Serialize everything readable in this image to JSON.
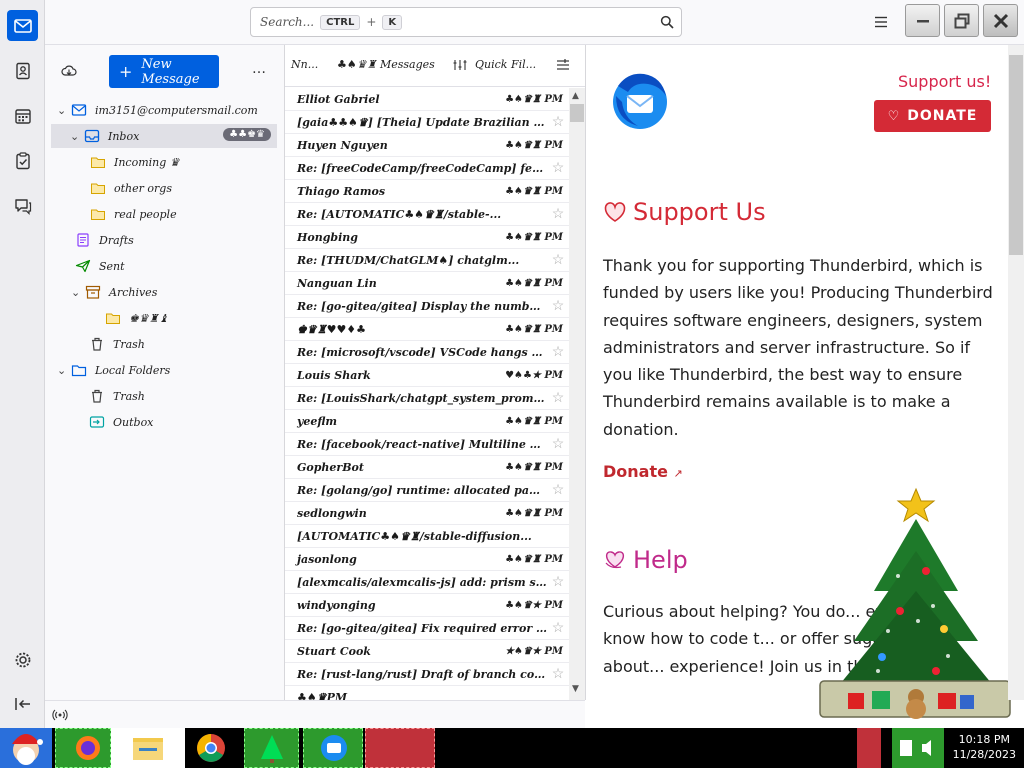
{
  "search": {
    "placeholder": "Search...",
    "key1": "CTRL",
    "sep": "+",
    "key2": "K"
  },
  "folders": {
    "new_message": "New Message",
    "more": "…",
    "account": "im3151@computersmail.com",
    "items": [
      {
        "label": "Inbox",
        "badge": "♣♣♚♛"
      },
      {
        "label": "Incoming ♛"
      },
      {
        "label": "other orgs"
      },
      {
        "label": "real people"
      },
      {
        "label": "Drafts"
      },
      {
        "label": "Sent"
      },
      {
        "label": "Archives"
      },
      {
        "label": "♚♛♜♝"
      },
      {
        "label": "Trash"
      },
      {
        "label": "Local Folders"
      },
      {
        "label": "Trash"
      },
      {
        "label": "Outbox"
      }
    ]
  },
  "list_header": {
    "col1": "Nn...",
    "col2": "♣♠♛♜ Messages",
    "col3": "Quick Fil..."
  },
  "messages": [
    {
      "text": "Elliot Gabriel",
      "time": "♣♠♛♜ PM",
      "star": ""
    },
    {
      "text": "[gaia♣♣♠♛] [Theia] Update Brazilian Po...",
      "time": "",
      "star": "☆"
    },
    {
      "text": "Huyen Nguyen",
      "time": "♣♠♛♜ PM",
      "star": ""
    },
    {
      "text": "Re: [freeCodeCamp/freeCodeCamp] feat(cu...",
      "time": "",
      "star": "☆"
    },
    {
      "text": "Thiago Ramos",
      "time": "♣♠♛♜ PM",
      "star": ""
    },
    {
      "text": "Re: [AUTOMATIC♣♠♛♜/stable-...",
      "time": "",
      "star": "☆"
    },
    {
      "text": "Hongbing",
      "time": "♣♠♛♜ PM",
      "star": ""
    },
    {
      "text": "Re: [THUDM/ChatGLM♠] chatglm...",
      "time": "",
      "star": "☆"
    },
    {
      "text": "Nanguan Lin",
      "time": "♣♠♛♜ PM",
      "star": ""
    },
    {
      "text": "Re: [go-gitea/gitea] Display the number of ...",
      "time": "",
      "star": "☆"
    },
    {
      "text": "♚♛♜♥♥♦♣",
      "time": "♣♠♛♜ PM",
      "star": ""
    },
    {
      "text": "Re: [microsoft/vscode] VSCode hangs whe...",
      "time": "",
      "star": "☆"
    },
    {
      "text": "Louis Shark",
      "time": "♥♠♣★ PM",
      "star": ""
    },
    {
      "text": "Re: [LouisShark/chatgpt_system_prompt]...",
      "time": "",
      "star": "☆"
    },
    {
      "text": "yeeflm",
      "time": "♣♠♛♜ PM",
      "star": ""
    },
    {
      "text": "Re: [facebook/react-native] Multiline Text...",
      "time": "",
      "star": "☆"
    },
    {
      "text": "GopherBot",
      "time": "♣♠♛♜ PM",
      "star": ""
    },
    {
      "text": "Re: [golang/go] runtime: allocated pages bel...",
      "time": "",
      "star": "☆"
    },
    {
      "text": "sedlongwin",
      "time": "♣♠♛♜ PM",
      "star": ""
    },
    {
      "text": "[AUTOMATIC♣♠♛♜/stable-diffusion...",
      "time": "",
      "star": ""
    },
    {
      "text": "jasonlong",
      "time": "♣♠♛♜ PM",
      "star": ""
    },
    {
      "text": "[alexmcalis/alexmcalis-js] add: prism support...",
      "time": "",
      "star": "☆"
    },
    {
      "text": "windyonging",
      "time": "♣♠♛★ PM",
      "star": ""
    },
    {
      "text": "Re: [go-gitea/gitea] Fix required error for t...",
      "time": "",
      "star": "☆"
    },
    {
      "text": "Stuart Cook",
      "time": "★♠♛★ PM",
      "star": ""
    },
    {
      "text": "Re: [rust-lang/rust] Draft of branch cov...",
      "time": "",
      "star": "☆"
    },
    {
      "text": "♣♠♛PM",
      "time": "",
      "star": ""
    }
  ],
  "content": {
    "support_link": "Support us!",
    "donate_button": "DONATE",
    "support_heading": "Support Us",
    "support_text": "Thank you for supporting Thunderbird, which is funded by users like you! Producing Thunderbird requires software engineers, designers, system administrators and server infrastructure. So if you like Thunderbird, the best way to ensure Thunderbird remains available is to make a donation.",
    "donate_link": "Donate",
    "help_heading": "Help",
    "help_text": "Curious about helping? You do... expert or know how to code t... or offer suggestions about... experience! Join us in this c..."
  },
  "taskbar": {
    "time": "10:18 PM",
    "date": "11/28/2023"
  },
  "colors": {
    "accent": "#0060df",
    "donate": "#d42a36",
    "heading": "#d42a36",
    "help": "#c02a8a"
  }
}
